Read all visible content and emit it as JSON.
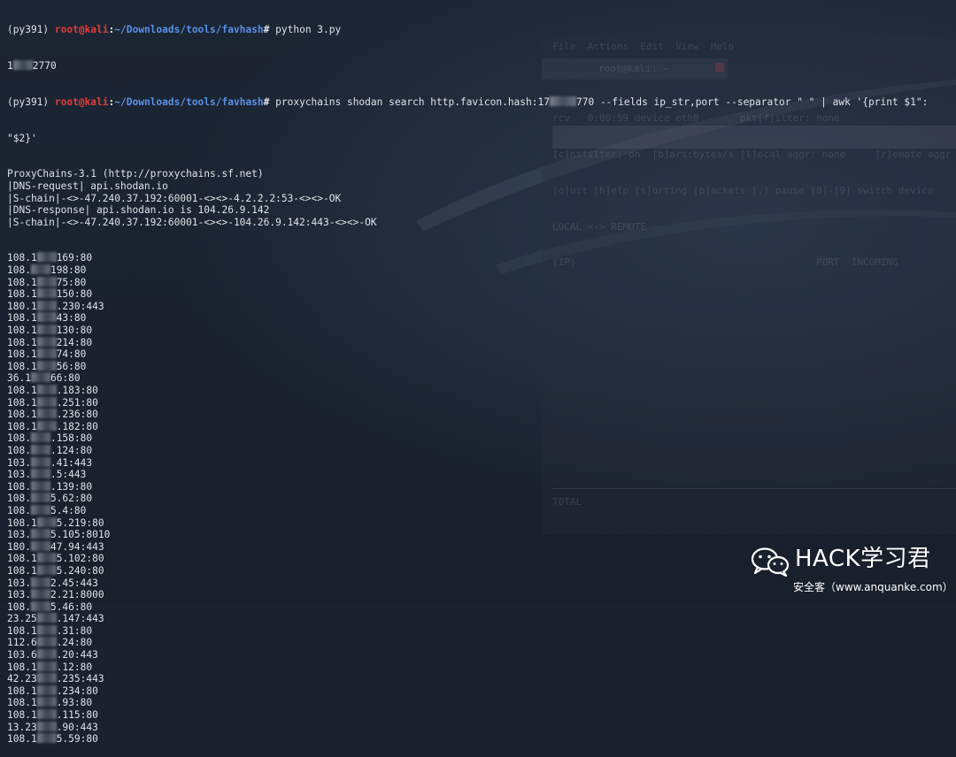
{
  "prompt": {
    "env": "(py391) ",
    "user_host": "root@kali",
    "sep": ":",
    "path": "~/Downloads/tools/favhash",
    "hash_mark": "# "
  },
  "commands": {
    "first": "python 3.py",
    "second_pre": "proxychains shodan search http.favicon.hash:17",
    "second_post": "770 --fields ip_str,port --separator \" \" | awk '{print $1\":",
    "second_cont": "\"$2}'"
  },
  "hash_output": {
    "pre": "1",
    "post": "2770"
  },
  "proxychains": [
    "ProxyChains-3.1 (http://proxychains.sf.net)",
    "|DNS-request| api.shodan.io",
    "|S-chain|-<>-47.240.37.192:60001-<><>-4.2.2.2:53-<><>-OK",
    "|DNS-response| api.shodan.io is 104.26.9.142",
    "|S-chain|-<>-47.240.37.192:60001-<><>-104.26.9.142:443-<><>-OK"
  ],
  "results": [
    {
      "pre": "108.1",
      "post": "169:80"
    },
    {
      "pre": "108.",
      "post": "198:80"
    },
    {
      "pre": "108.1",
      "post": "75:80"
    },
    {
      "pre": "108.1",
      "post": "150:80"
    },
    {
      "pre": "180.1",
      "post": ".230:443"
    },
    {
      "pre": "108.1",
      "post": "43:80"
    },
    {
      "pre": "108.1",
      "post": "130:80"
    },
    {
      "pre": "108.1",
      "post": "214:80"
    },
    {
      "pre": "108.1",
      "post": "74:80"
    },
    {
      "pre": "108.1",
      "post": "56:80"
    },
    {
      "pre": "36.1",
      "post": "66:80"
    },
    {
      "pre": "108.1",
      "post": ".183:80"
    },
    {
      "pre": "108.1",
      "post": ".251:80"
    },
    {
      "pre": "108.1",
      "post": ".236:80"
    },
    {
      "pre": "108.1",
      "post": ".182:80"
    },
    {
      "pre": "108.",
      "post": ".158:80"
    },
    {
      "pre": "108.",
      "post": ".124:80"
    },
    {
      "pre": "103.",
      "post": ".41:443"
    },
    {
      "pre": "103.",
      "post": ".5:443"
    },
    {
      "pre": "108.",
      "post": ".139:80"
    },
    {
      "pre": "108.",
      "post": "5.62:80"
    },
    {
      "pre": "108.",
      "post": "5.4:80"
    },
    {
      "pre": "108.1",
      "post": "5.219:80"
    },
    {
      "pre": "103.",
      "post": "5.105:8010"
    },
    {
      "pre": "180.",
      "post": "47.94:443"
    },
    {
      "pre": "108.1",
      "post": "5.102:80"
    },
    {
      "pre": "108.1",
      "post": "5.240:80"
    },
    {
      "pre": "103.",
      "post": "2.45:443"
    },
    {
      "pre": "103.",
      "post": "2.21:8000"
    },
    {
      "pre": "108.",
      "post": "5.46:80"
    },
    {
      "pre": "23.25",
      "post": ".147:443"
    },
    {
      "pre": "108.1",
      "post": ".31:80"
    },
    {
      "pre": "112.6",
      "post": ".24:80"
    },
    {
      "pre": "103.6",
      "post": ".20:443"
    },
    {
      "pre": "108.1",
      "post": ".12:80"
    },
    {
      "pre": "42.23",
      "post": ".235:443"
    },
    {
      "pre": "108.1",
      "post": ".234:80"
    },
    {
      "pre": "108.1",
      "post": ".93:80"
    },
    {
      "pre": "108.1",
      "post": ".115:80"
    },
    {
      "pre": "13.23",
      "post": ".90:443"
    },
    {
      "pre": "108.1",
      "post": "5.59:80"
    }
  ],
  "background_window": {
    "menubar": "File  Actions  Edit  View  Help",
    "title": "root@kali: ~",
    "lines": [
      "rcv   0:00:59 device eth0       pkt[f]ilter: none",
      "[c]ntfilter: on  [b]ars:bytes/s [l]ocal aggr: none     [r]emote aggr",
      "[q]uit [h]elp [s]orting [p]ackets [,] pause [0]-[9] switch device",
      "LOCAL <-> REMOTE",
      "(IP)                                         PORT  INCOMING"
    ],
    "total": "TOTAL"
  },
  "watermark": {
    "title": "HACK学习君",
    "subtitle": "安全客（www.anquanke.com）"
  }
}
